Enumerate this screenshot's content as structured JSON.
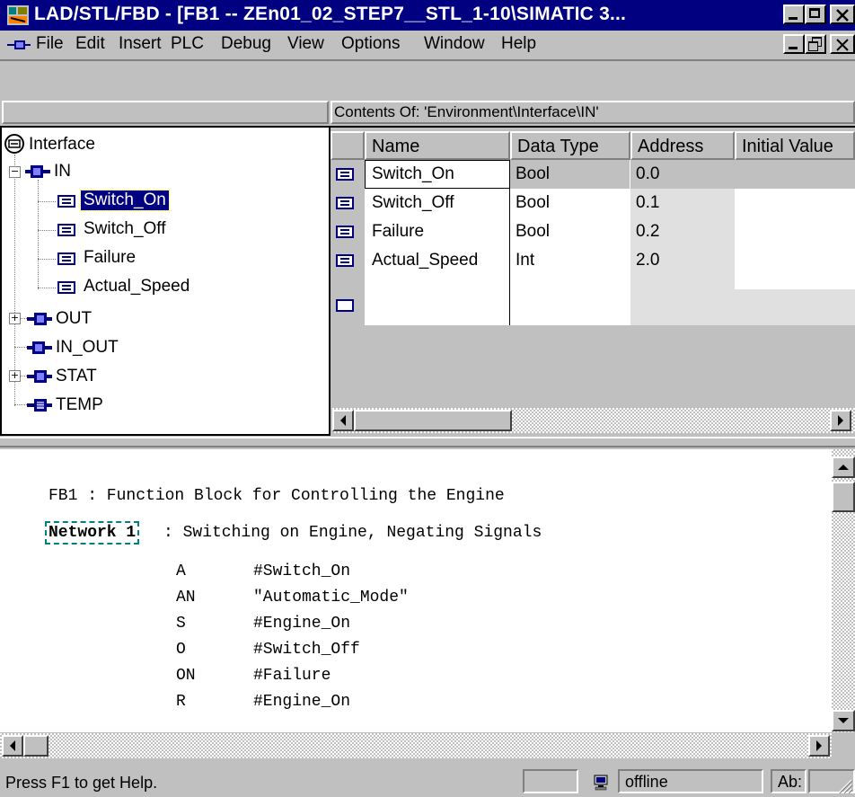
{
  "window": {
    "title": "LAD/STL/FBD  - [FB1 -- ZEn01_02_STEP7__STL_1-10\\SIMATIC 3..."
  },
  "menu": {
    "items": [
      "File",
      "Edit",
      "Insert",
      "PLC",
      "Debug",
      "View",
      "Options",
      "Window",
      "Help"
    ]
  },
  "declaration": {
    "contents_label": "Contents Of: 'Environment\\Interface\\IN'",
    "tree": {
      "root": "Interface",
      "nodes": {
        "in": "IN",
        "switch_on": "Switch_On",
        "switch_off": "Switch_Off",
        "failure": "Failure",
        "actual_speed": "Actual_Speed",
        "out": "OUT",
        "in_out": "IN_OUT",
        "stat": "STAT",
        "temp": "TEMP"
      },
      "selected": "Switch_On"
    },
    "table": {
      "headers": [
        "Name",
        "Data Type",
        "Address",
        "Initial Value"
      ],
      "rows": [
        [
          "Switch_On",
          "Bool",
          "0.0",
          ""
        ],
        [
          "Switch_Off",
          "Bool",
          "0.1",
          ""
        ],
        [
          "Failure",
          "Bool",
          "0.2",
          ""
        ],
        [
          "Actual_Speed",
          "Int",
          "2.0",
          ""
        ]
      ]
    }
  },
  "code": {
    "block_title": "FB1 : Function Block for Controlling the Engine",
    "network_label": "Network 1",
    "network_title": ": Switching on Engine, Negating Signals",
    "lines": [
      {
        "op": "A",
        "operand": "#Switch_On"
      },
      {
        "op": "AN",
        "operand": "\"Automatic_Mode\""
      },
      {
        "op": "S",
        "operand": "#Engine_On"
      },
      {
        "op": "O",
        "operand": "#Switch_Off"
      },
      {
        "op": "ON",
        "operand": "#Failure"
      },
      {
        "op": "R",
        "operand": "#Engine_On"
      }
    ]
  },
  "status": {
    "help_text": "Press F1 to get Help.",
    "mode": "offline",
    "field": "Ab:"
  },
  "colors": {
    "titlebar": "#000080",
    "selection": "#000080",
    "face": "#c0c0c0"
  }
}
